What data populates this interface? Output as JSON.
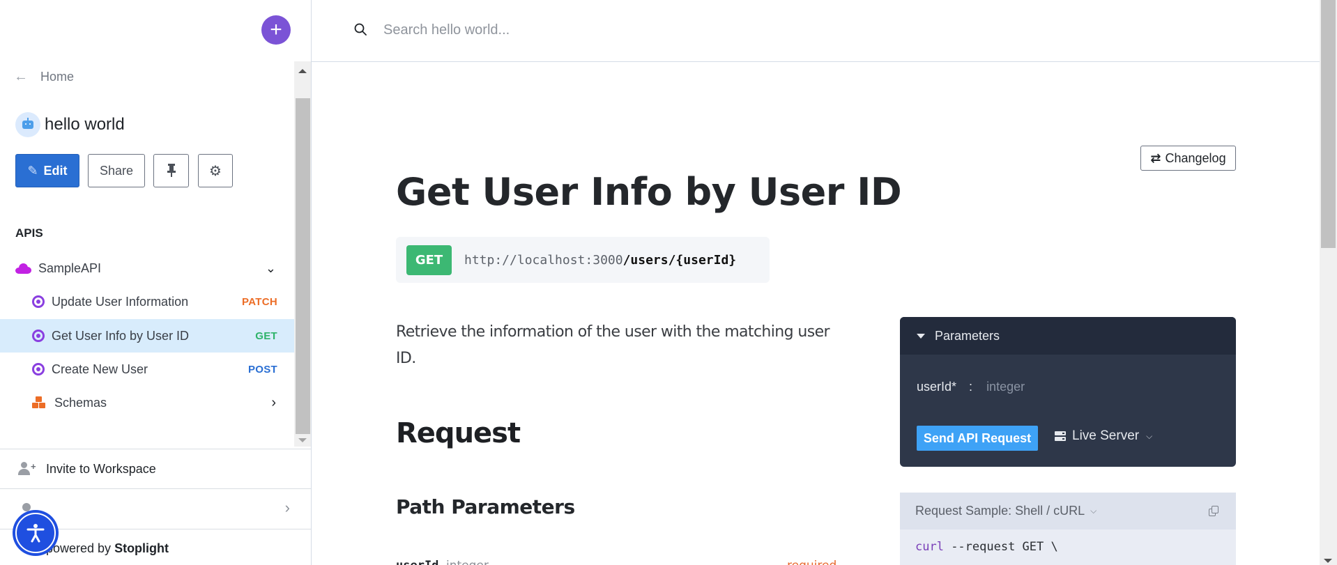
{
  "sidebar": {
    "add_button_label": "+",
    "home_label": "Home",
    "project_name": "hello world",
    "buttons": {
      "edit": "Edit",
      "share": "Share"
    },
    "section_label": "APIS",
    "api_group": {
      "label": "SampleAPI",
      "expanded": true
    },
    "endpoints": [
      {
        "label": "Update User Information",
        "method": "PATCH",
        "method_color": "#ec6d26",
        "active": false
      },
      {
        "label": "Get User Info by User ID",
        "method": "GET",
        "method_color": "#2fb36a",
        "active": true
      },
      {
        "label": "Create New User",
        "method": "POST",
        "method_color": "#2a6fd3",
        "active": false
      }
    ],
    "schemas_label": "Schemas",
    "invite_label": "Invite to Workspace",
    "powered_prefix": "powered by ",
    "powered_brand": "Stoplight"
  },
  "header": {
    "search_placeholder": "Search hello world..."
  },
  "main": {
    "changelog_label": "Changelog",
    "title": "Get User Info by User ID",
    "method": "GET",
    "url_base": "http://localhost:3000",
    "url_path": "/users/{userId}",
    "description": "Retrieve the information of the user with the matching user ID.",
    "request_heading": "Request",
    "path_params_heading": "Path Parameters",
    "path_param": {
      "name": "userId",
      "type": "integer",
      "required_label": "required"
    }
  },
  "try_it": {
    "panel_title": "Parameters",
    "param_name": "userId*",
    "param_separator": ":",
    "param_placeholder": "integer",
    "send_label": "Send API Request",
    "server_label": "Live Server"
  },
  "request_sample": {
    "title": "Request Sample: Shell / cURL",
    "code_keyword": "curl",
    "code_rest": " --request GET \\"
  },
  "colors": {
    "accent_purple": "#7b53d6",
    "edit_blue": "#2a6fd3",
    "get_green": "#3cb873",
    "send_blue": "#3ea2f6",
    "panel_dark": "#2e3749"
  }
}
